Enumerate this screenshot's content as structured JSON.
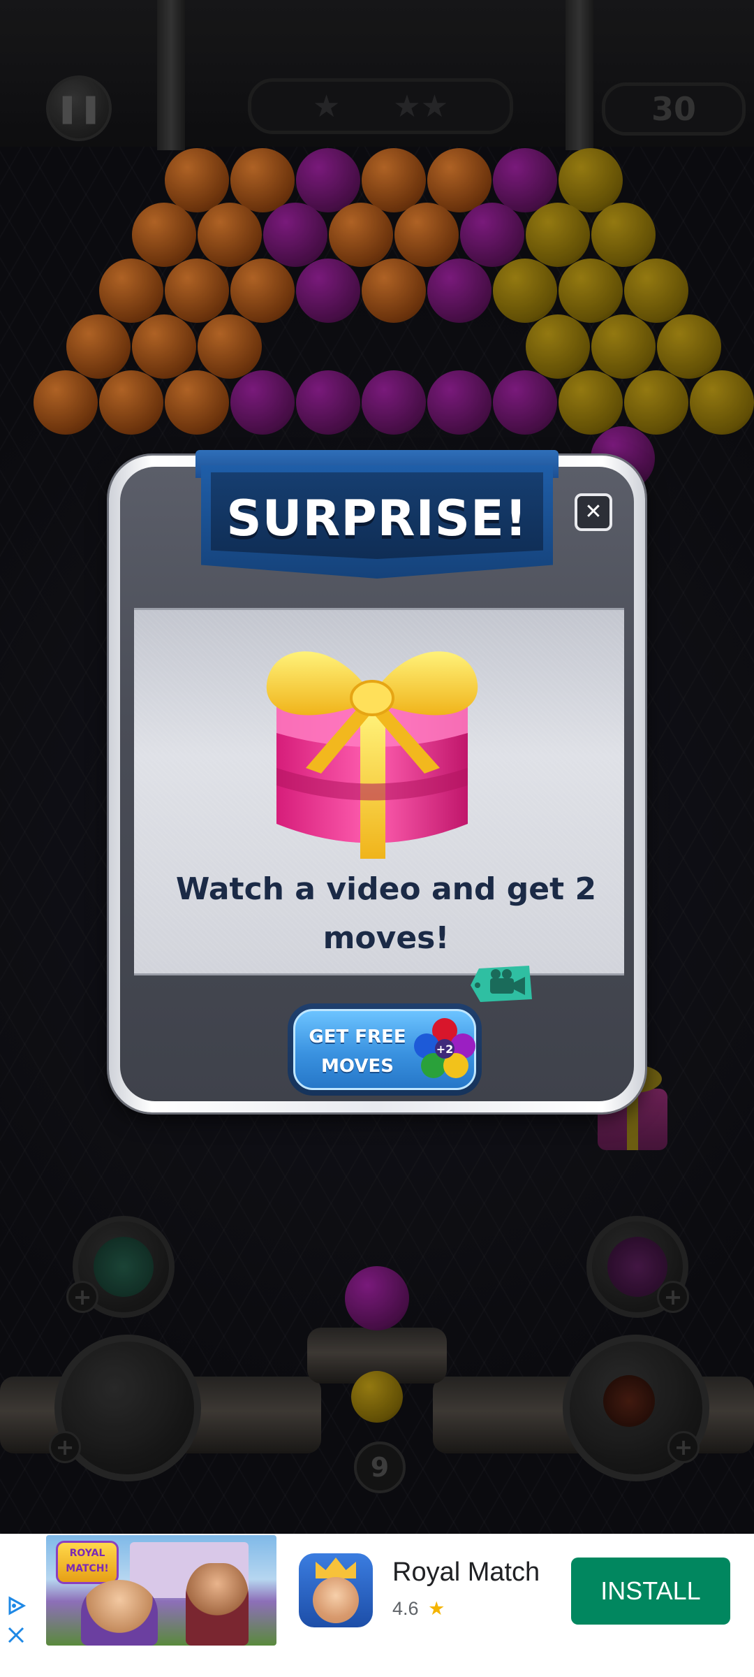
{
  "hud": {
    "pause_icon": "pause-icon",
    "stars": [
      "★",
      "★★"
    ],
    "moves_left": "30"
  },
  "board": {
    "bubble_colors": {
      "orange": "#c7702a",
      "purple": "#8a1e8c",
      "yellow": "#a88a14"
    },
    "shooter_moves": "9"
  },
  "modal": {
    "title": "SURPRISE!",
    "close_label": "✕",
    "message_line1": "Watch a video and get 2",
    "message_line2": "moves!",
    "button_line1": "GET FREE",
    "button_line2": "MOVES",
    "button_badge": "+2",
    "video_tag_icon": "video-camera-icon"
  },
  "ad": {
    "app_name": "Royal Match",
    "rating": "4.6",
    "rating_star": "★",
    "install_label": "INSTALL",
    "banner_logo_line1": "ROYAL",
    "banner_logo_line2": "MATCH!",
    "install_color": "#01875f"
  }
}
